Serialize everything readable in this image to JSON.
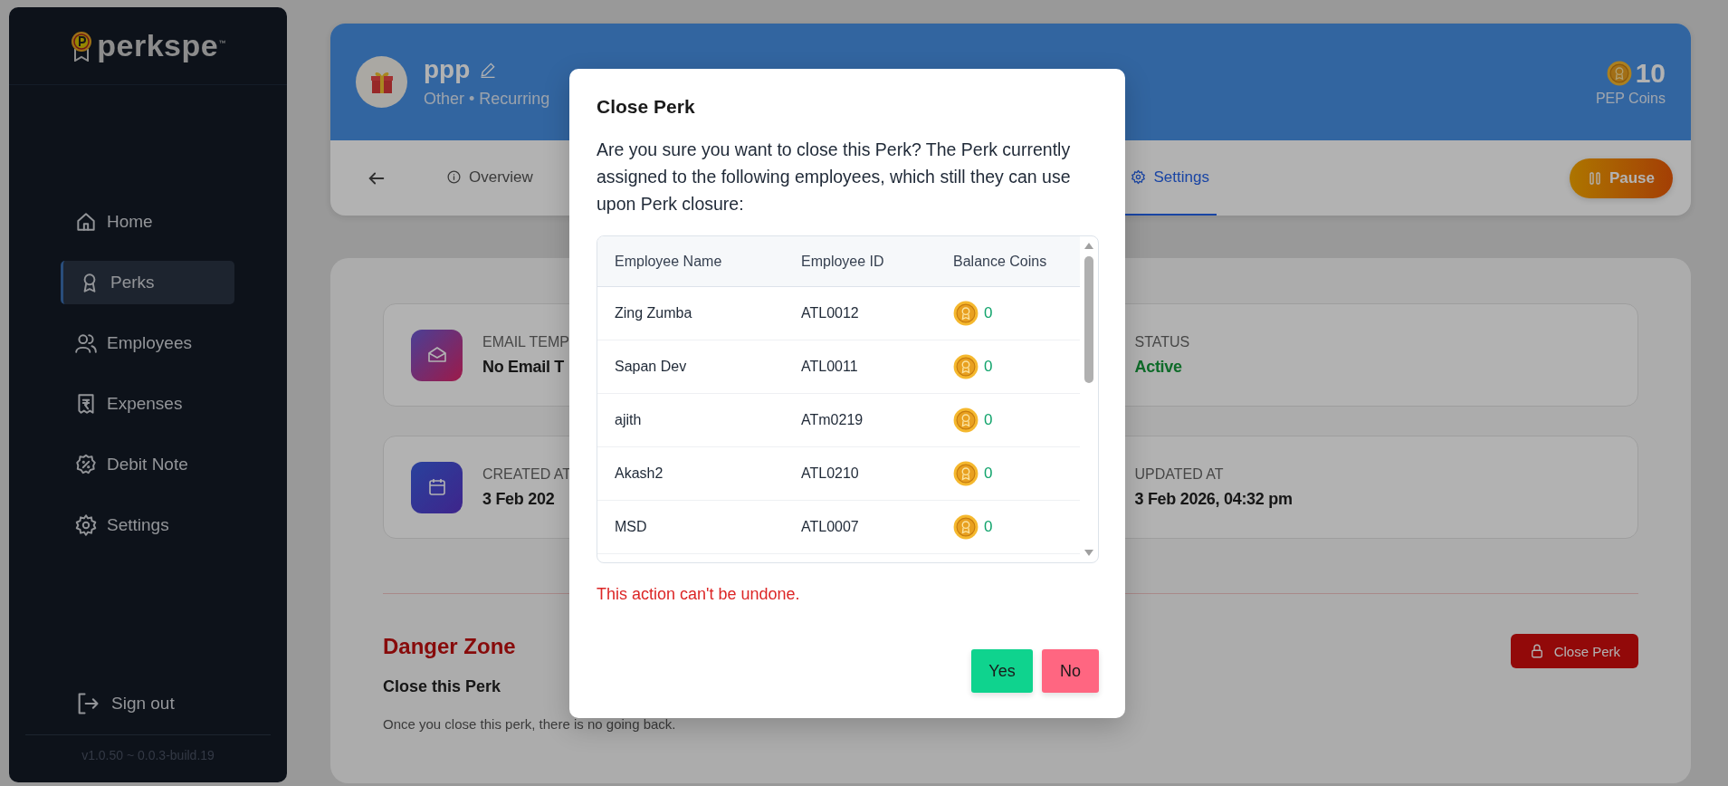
{
  "sidebar": {
    "logo": "perkspe$^{™}$",
    "items": [
      {
        "label": "Home",
        "selected": false
      },
      {
        "label": "Perks",
        "selected": true
      },
      {
        "label": "Employees",
        "selected": false
      },
      {
        "label": "Expenses",
        "selected": false
      },
      {
        "label": "Debit Note",
        "selected": false
      },
      {
        "label": "Settings",
        "selected": false
      }
    ],
    "sign_out": "Sign out",
    "version": "v1.0.50 ~ 0.0.3-build.19"
  },
  "header": {
    "title": "ppp",
    "subtitle": "Other • Recurring",
    "coins": "10",
    "coins_label": "PEP Coins"
  },
  "tabs": [
    {
      "label": "Overview",
      "selected": false
    },
    {
      "label": "Settings",
      "selected": true
    }
  ],
  "pause_button": "Pause",
  "info_cards": [
    {
      "label": "EMAIL TEMP",
      "value": "No Email T",
      "kind": "email"
    },
    {
      "label": "STATUS",
      "value": "Active",
      "kind": "status"
    },
    {
      "label": "CREATED AT",
      "value": "3 Feb 202",
      "kind": "date"
    },
    {
      "label": "UPDATED AT",
      "value": "3 Feb 2026, 04:32 pm",
      "kind": "hidden"
    }
  ],
  "danger_zone": {
    "title": "Danger Zone",
    "button": "Close Perk",
    "subtitle": "Close this Perk",
    "description": "Once you close this perk, there is no going back."
  },
  "modal": {
    "title": "Close Perk",
    "message": "Are you sure you want to close this Perk? The Perk currently assigned to the following employees, which still they can use upon Perk closure:",
    "columns": [
      "Employee Name",
      "Employee ID",
      "Balance Coins"
    ],
    "rows": [
      {
        "name": "Zing Zumba",
        "id": "ATL0012",
        "coins": "0"
      },
      {
        "name": "Sapan Dev",
        "id": "ATL0011",
        "coins": "0"
      },
      {
        "name": "ajith",
        "id": "ATm0219",
        "coins": "0"
      },
      {
        "name": "Akash2",
        "id": "ATL0210",
        "coins": "0"
      },
      {
        "name": "MSD",
        "id": "ATL0007",
        "coins": "0"
      }
    ],
    "warning": "This action can't be undone.",
    "buttons": [
      {
        "label": "Yes",
        "kind": "confirm"
      },
      {
        "label": "No",
        "kind": "cancel"
      }
    ]
  }
}
